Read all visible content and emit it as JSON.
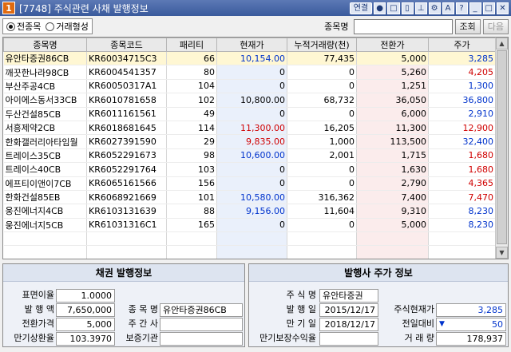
{
  "window": {
    "screen_no": "1",
    "title": "[7748] 주식관련 사채 발행정보"
  },
  "titlebar_tools": {
    "link": "연결",
    "help": "?",
    "font": "A"
  },
  "toolbar": {
    "radio_all": "전종목",
    "radio_exchange": "거래형성",
    "search_label": "종목명",
    "search_value": "",
    "search_button": "조회",
    "next_button": "다음"
  },
  "table": {
    "headers": [
      "종목명",
      "종목코드",
      "패리티",
      "현재가",
      "누적거래량(천)",
      "전환가",
      "주가"
    ],
    "rows": [
      {
        "name": "유안타증권86CB",
        "code": "KR60034715C3",
        "parity": "66",
        "price": "10,154.00",
        "price_color": "blue",
        "volume": "77,435",
        "conv": "5,000",
        "stock": "3,285",
        "stock_color": "blue",
        "selected": true
      },
      {
        "name": "깨끗한나라98CB",
        "code": "KR6004541357",
        "parity": "80",
        "price": "0",
        "price_color": "",
        "volume": "0",
        "conv": "5,260",
        "stock": "4,205",
        "stock_color": "red"
      },
      {
        "name": "부산주공4CB",
        "code": "KR60050317A1",
        "parity": "104",
        "price": "0",
        "price_color": "",
        "volume": "0",
        "conv": "1,251",
        "stock": "1,300",
        "stock_color": "blue"
      },
      {
        "name": "아이에스동서33CB",
        "code": "KR6010781658",
        "parity": "102",
        "price": "10,800.00",
        "price_color": "",
        "volume": "68,732",
        "conv": "36,050",
        "stock": "36,800",
        "stock_color": "blue"
      },
      {
        "name": "두산건설85CB",
        "code": "KR6011161561",
        "parity": "49",
        "price": "0",
        "price_color": "",
        "volume": "0",
        "conv": "6,000",
        "stock": "2,910",
        "stock_color": "blue"
      },
      {
        "name": "서흥제약2CB",
        "code": "KR6018681645",
        "parity": "114",
        "price": "11,300.00",
        "price_color": "red",
        "volume": "16,205",
        "conv": "11,300",
        "stock": "12,900",
        "stock_color": "red"
      },
      {
        "name": "한화갤러리아타임월",
        "code": "KR6027391590",
        "parity": "29",
        "price": "9,835.00",
        "price_color": "red",
        "volume": "1,000",
        "conv": "113,500",
        "stock": "32,400",
        "stock_color": "blue"
      },
      {
        "name": "트레이스35CB",
        "code": "KR6052291673",
        "parity": "98",
        "price": "10,600.00",
        "price_color": "blue",
        "volume": "2,001",
        "conv": "1,715",
        "stock": "1,680",
        "stock_color": "red"
      },
      {
        "name": "트레이스40CB",
        "code": "KR6052291764",
        "parity": "103",
        "price": "0",
        "price_color": "",
        "volume": "0",
        "conv": "1,630",
        "stock": "1,680",
        "stock_color": "red"
      },
      {
        "name": "에프티이앤이7CB",
        "code": "KR6065161566",
        "parity": "156",
        "price": "0",
        "price_color": "",
        "volume": "0",
        "conv": "2,790",
        "stock": "4,365",
        "stock_color": "red"
      },
      {
        "name": "한화건설85EB",
        "code": "KR6068921669",
        "parity": "101",
        "price": "10,580.00",
        "price_color": "blue",
        "volume": "316,362",
        "conv": "7,400",
        "stock": "7,470",
        "stock_color": "red"
      },
      {
        "name": "웅진에너지4CB",
        "code": "KR6103131639",
        "parity": "88",
        "price": "9,156.00",
        "price_color": "blue",
        "volume": "11,604",
        "conv": "9,310",
        "stock": "8,230",
        "stock_color": "blue"
      },
      {
        "name": "웅진에너지5CB",
        "code": "KR61031316C1",
        "parity": "165",
        "price": "0",
        "price_color": "",
        "volume": "0",
        "conv": "5,000",
        "stock": "8,230",
        "stock_color": "blue"
      }
    ],
    "blank_rows": 2
  },
  "bond_panel": {
    "title": "채권 발행정보",
    "coupon_label": "표면이율",
    "coupon": "1.0000",
    "amount_label": "발 행 액",
    "amount": "7,650,000",
    "conv_price_label": "전환가격",
    "conv_price": "5,000",
    "redemption_label": "만기상환율",
    "redemption": "103.3970",
    "name_label": "종 목 명",
    "name": "유안타증권86CB",
    "manager_label": "주 간 사",
    "manager": "",
    "guarantor_label": "보증기관",
    "guarantor": ""
  },
  "issuer_panel": {
    "title": "발행사 주가 정보",
    "stock_name_label": "주 식 명",
    "stock_name": "유안타증권",
    "issue_date_label": "발 행 일",
    "issue_date": "2015/12/17",
    "maturity_label": "만 기 일",
    "maturity": "2018/12/17",
    "ytm_label": "만기보장수익율",
    "ytm": "",
    "price_label": "주식현재가",
    "price": "3,285",
    "change_label": "전일대비",
    "change": "50",
    "volume_label": "거 래 량",
    "volume": "178,937"
  },
  "colors": {
    "red": "#d00000",
    "blue": "#0033cc",
    "selected_row": "#fff7d3"
  }
}
